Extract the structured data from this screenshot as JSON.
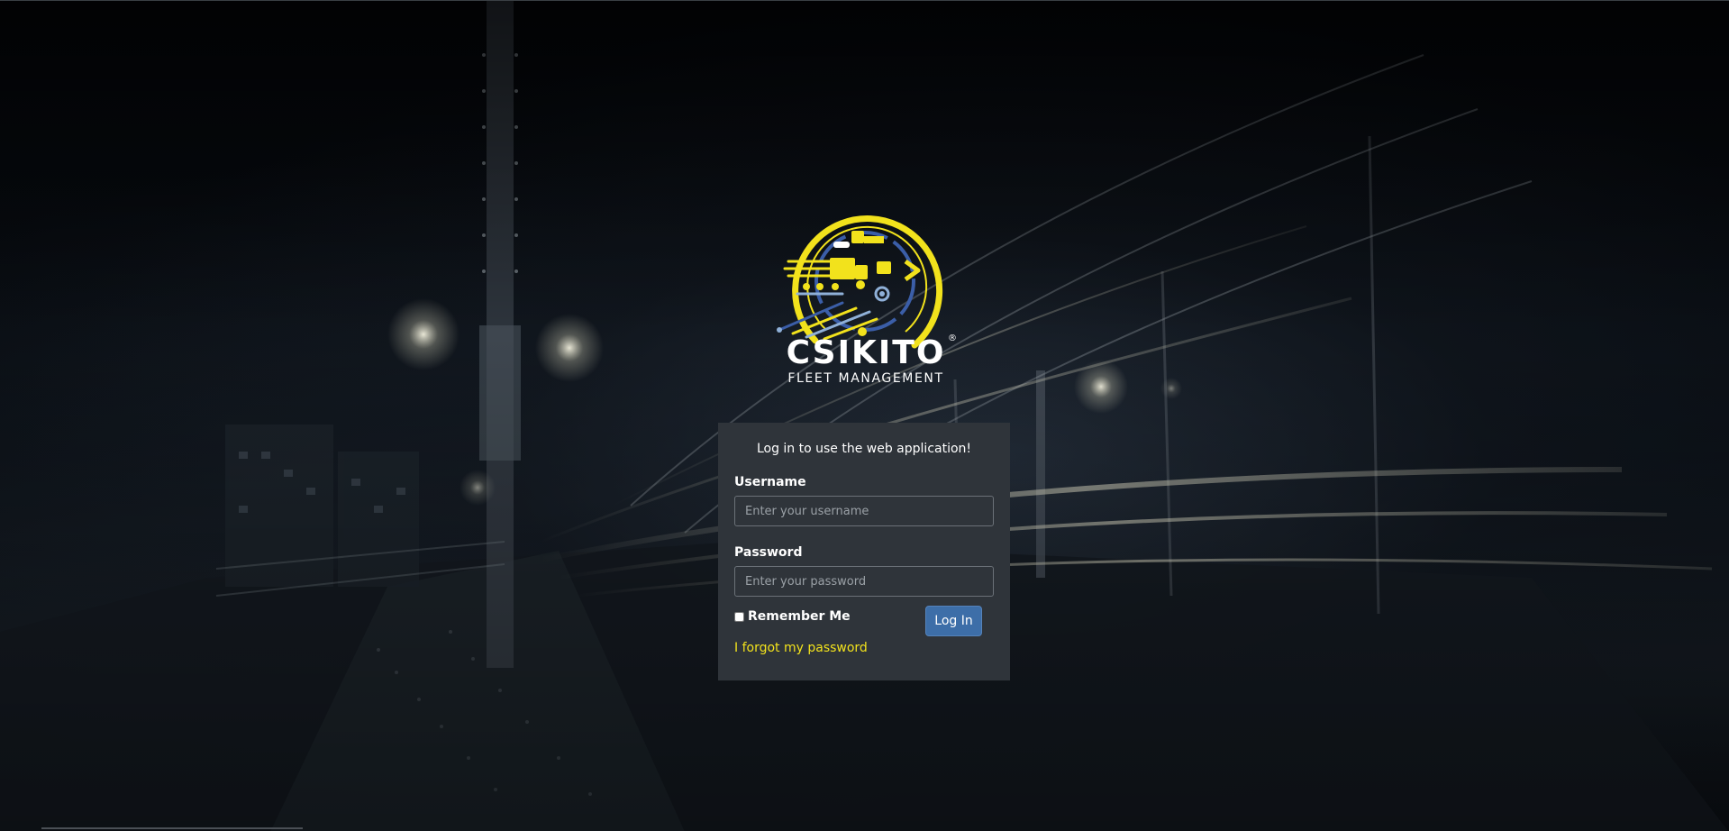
{
  "brand": {
    "name": "CSIKITO",
    "registered_mark": "®",
    "subtitle": "FLEET MANAGEMENT",
    "logo_icon": "fleet-truck-emblem-icon",
    "accent_color": "#f2e21c",
    "secondary_color": "#3b5ea8"
  },
  "login": {
    "title": "Log in to use the web application!",
    "username_label": "Username",
    "username_placeholder": "Enter your username",
    "username_value": "",
    "password_label": "Password",
    "password_placeholder": "Enter your password",
    "password_value": "",
    "remember_label": "Remember Me",
    "remember_checked": false,
    "submit_label": "Log In",
    "forgot_label": "I forgot my password"
  },
  "colors": {
    "panel_bg": "#2f343a",
    "button_bg": "#3d6ea8",
    "link": "#f2e21c"
  }
}
